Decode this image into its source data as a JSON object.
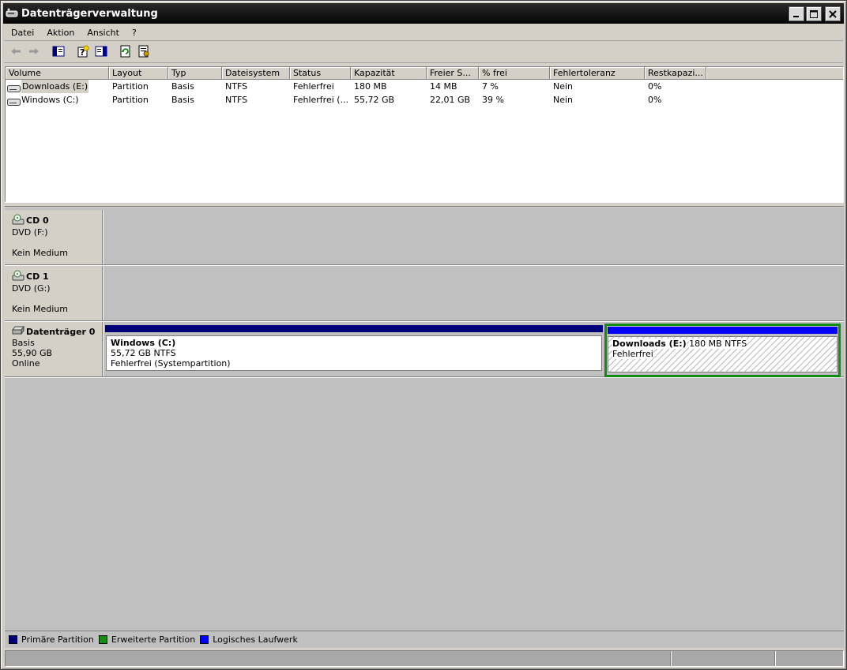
{
  "window": {
    "title": "Datenträgerverwaltung",
    "buttons": {
      "minimize": "minimize-icon",
      "maximize": "maximize-icon",
      "close": "close-icon"
    }
  },
  "menu": [
    "Datei",
    "Aktion",
    "Ansicht",
    "?"
  ],
  "toolbar": [
    "back-arrow-icon",
    "forward-arrow-icon",
    "show-hide-console-tree-icon",
    "help-icon",
    "show-hide-action-pane-icon",
    "refresh-icon",
    "properties-icon"
  ],
  "volumes": {
    "columns": [
      "Volume",
      "Layout",
      "Typ",
      "Dateisystem",
      "Status",
      "Kapazität",
      "Freier S...",
      "% frei",
      "Fehlertoleranz",
      "Restkapazi..."
    ],
    "rows": [
      [
        "Downloads (E:)",
        "Partition",
        "Basis",
        "NTFS",
        "Fehlerfrei",
        "180 MB",
        "14 MB",
        "7 %",
        "Nein",
        "0%"
      ],
      [
        "Windows (C:)",
        "Partition",
        "Basis",
        "NTFS",
        "Fehlerfrei (...",
        "55,72 GB",
        "22,01 GB",
        "39 %",
        "Nein",
        "0%"
      ]
    ]
  },
  "disks": [
    {
      "title": "CD 0",
      "line1": "DVD (F:)",
      "line2": "",
      "line3": "Kein Medium"
    },
    {
      "title": "CD 1",
      "line1": "DVD (G:)",
      "line2": "",
      "line3": "Kein Medium"
    },
    {
      "title": "Datenträger 0",
      "line1": "Basis",
      "line2": "55,90 GB",
      "line3": "Online",
      "partitions": [
        {
          "name": "Windows  (C:)",
          "size": "55,72 GB NTFS",
          "status": "Fehlerfrei (Systempartition)",
          "color": "#00007b"
        },
        {
          "name": "Downloads  (E:)",
          "size": "180 MB NTFS",
          "status": "Fehlerfrei",
          "color": "#0000ff",
          "container_color": "#148c14"
        }
      ]
    }
  ],
  "legend": [
    {
      "label": "Primäre Partition",
      "color": "#00007b"
    },
    {
      "label": "Erweiterte Partition",
      "color": "#148c14"
    },
    {
      "label": "Logisches Laufwerk",
      "color": "#0000ff"
    }
  ]
}
